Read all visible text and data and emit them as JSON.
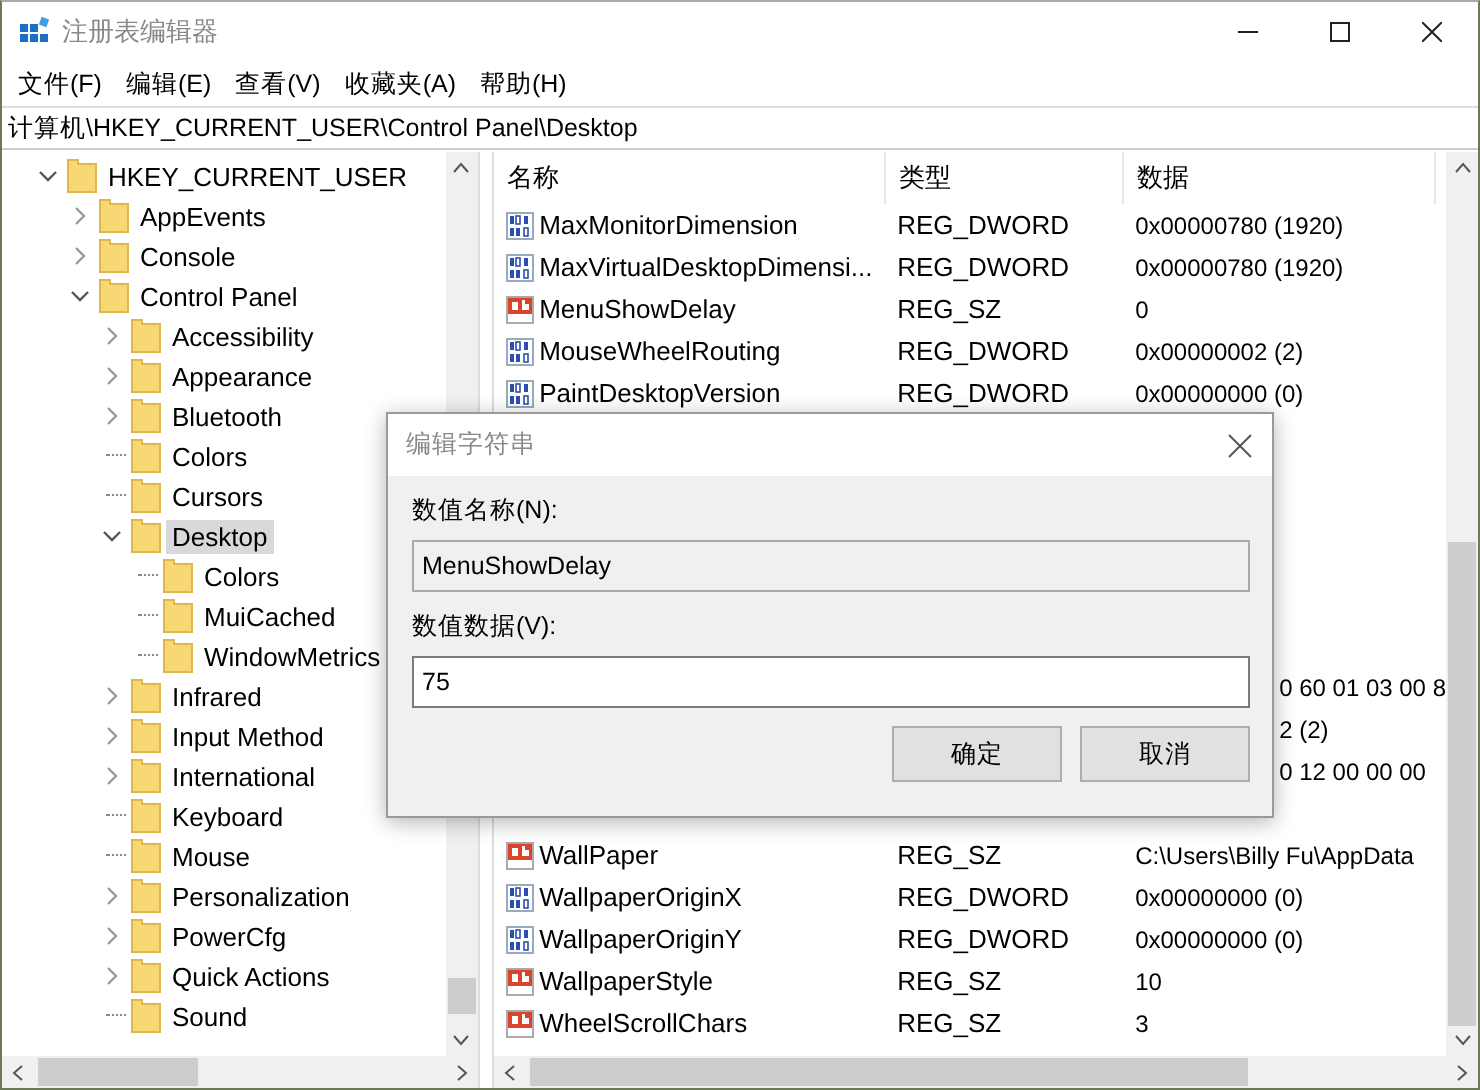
{
  "window": {
    "title": "注册表编辑器"
  },
  "menu": [
    "文件(F)",
    "编辑(E)",
    "查看(V)",
    "收藏夹(A)",
    "帮助(H)"
  ],
  "address": "计算机\\HKEY_CURRENT_USER\\Control Panel\\Desktop",
  "tree": [
    {
      "label": "HKEY_CURRENT_USER",
      "expanded": true,
      "selected": false,
      "children": [
        {
          "label": "AppEvents",
          "expanded": false,
          "selected": false
        },
        {
          "label": "Console",
          "expanded": false,
          "selected": false
        },
        {
          "label": "Control Panel",
          "expanded": true,
          "selected": false,
          "children": [
            {
              "label": "Accessibility",
              "expanded": false,
              "selected": false
            },
            {
              "label": "Appearance",
              "expanded": false,
              "selected": false
            },
            {
              "label": "Bluetooth",
              "expanded": false,
              "selected": false
            },
            {
              "label": "Colors",
              "selected": false
            },
            {
              "label": "Cursors",
              "selected": false
            },
            {
              "label": "Desktop",
              "expanded": true,
              "selected": true,
              "children": [
                {
                  "label": "Colors",
                  "selected": false
                },
                {
                  "label": "MuiCached",
                  "selected": false
                },
                {
                  "label": "WindowMetrics",
                  "selected": false
                }
              ]
            },
            {
              "label": "Infrared",
              "expanded": false,
              "selected": false
            },
            {
              "label": "Input Method",
              "expanded": false,
              "selected": false
            },
            {
              "label": "International",
              "expanded": false,
              "selected": false
            },
            {
              "label": "Keyboard",
              "selected": false
            },
            {
              "label": "Mouse",
              "selected": false
            },
            {
              "label": "Personalization",
              "expanded": false,
              "selected": false
            },
            {
              "label": "PowerCfg",
              "expanded": false,
              "selected": false
            },
            {
              "label": "Quick Actions",
              "expanded": false,
              "selected": false
            },
            {
              "label": "Sound",
              "selected": false
            }
          ]
        }
      ]
    }
  ],
  "list": {
    "columns": [
      "名称",
      "类型",
      "数据"
    ],
    "rows": [
      {
        "kind": "dword",
        "name": "MaxMonitorDimension",
        "type": "REG_DWORD",
        "data": "0x00000780 (1920)"
      },
      {
        "kind": "dword",
        "name": "MaxVirtualDesktopDimensi...",
        "type": "REG_DWORD",
        "data": "0x00000780 (1920)"
      },
      {
        "kind": "string",
        "name": "MenuShowDelay",
        "type": "REG_SZ",
        "data": "0"
      },
      {
        "kind": "dword",
        "name": "MouseWheelRouting",
        "type": "REG_DWORD",
        "data": "0x00000002 (2)"
      },
      {
        "kind": "dword",
        "name": "PaintDesktopVersion",
        "type": "REG_DWORD",
        "data": "0x00000000 (0)"
      },
      {
        "kind": "covered"
      },
      {
        "kind": "covered"
      },
      {
        "kind": "covered"
      },
      {
        "kind": "covered"
      },
      {
        "kind": "covered"
      },
      {
        "kind": "covered"
      },
      {
        "kind": "covered",
        "data": "0 60 01 03 00 8"
      },
      {
        "kind": "covered",
        "data": "2 (2)"
      },
      {
        "kind": "covered",
        "data": "0 12 00 00 00"
      },
      {
        "kind": "covered"
      },
      {
        "kind": "string",
        "name": "WallPaper",
        "type": "REG_SZ",
        "data": "C:\\Users\\Billy Fu\\AppData"
      },
      {
        "kind": "dword",
        "name": "WallpaperOriginX",
        "type": "REG_DWORD",
        "data": "0x00000000 (0)"
      },
      {
        "kind": "dword",
        "name": "WallpaperOriginY",
        "type": "REG_DWORD",
        "data": "0x00000000 (0)"
      },
      {
        "kind": "string",
        "name": "WallpaperStyle",
        "type": "REG_SZ",
        "data": "10"
      },
      {
        "kind": "string",
        "name": "WheelScrollChars",
        "type": "REG_SZ",
        "data": "3"
      }
    ]
  },
  "dialog": {
    "title": "编辑字符串",
    "name_label": "数值名称(N):",
    "name_value": "MenuShowDelay",
    "data_label": "数值数据(V):",
    "data_value": "75",
    "buttons": [
      "确定",
      "取消"
    ]
  }
}
